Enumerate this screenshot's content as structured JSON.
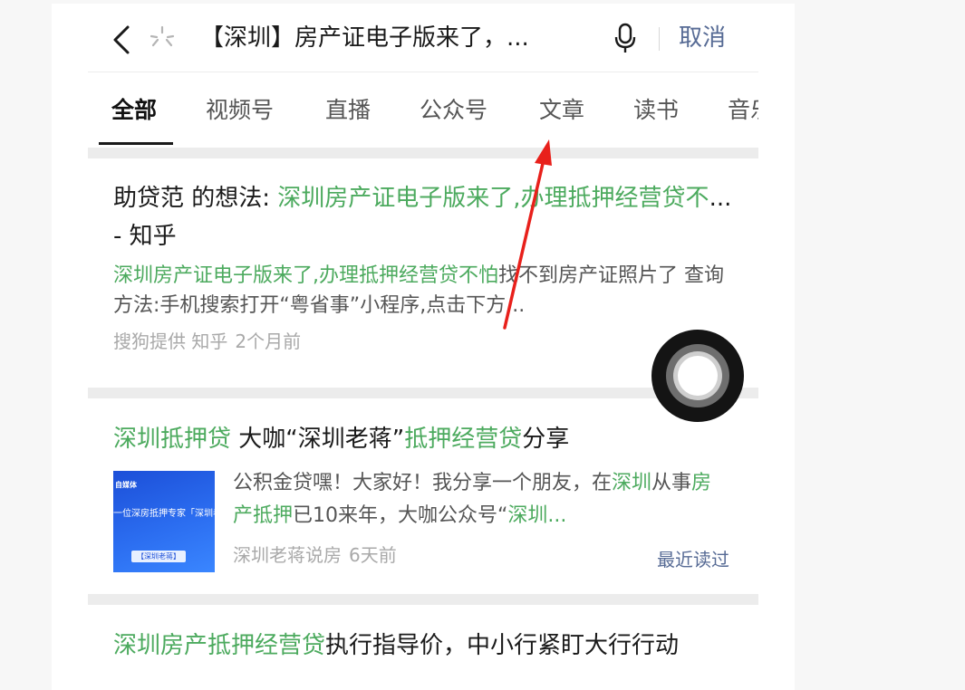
{
  "search": {
    "query": "【深圳】房产证电子版来了，...",
    "cancel_label": "取消"
  },
  "tabs": [
    {
      "label": "全部",
      "active": true
    },
    {
      "label": "视频号"
    },
    {
      "label": "直播"
    },
    {
      "label": "公众号"
    },
    {
      "label": "文章"
    },
    {
      "label": "读书"
    },
    {
      "label": "音乐"
    }
  ],
  "results": [
    {
      "title_plain": "助贷范 的想法: ",
      "title_hl": "深圳房产证电子版来了,办理抵押经营贷不",
      "title_tail": "... - 知乎",
      "desc_hl": "深圳房产证电子版来了,办理抵押经营贷不怕",
      "desc_plain": "找不到房产证照片了 查询方法:手机搜索打开“粤省事”小程序,点击下方...",
      "source": "搜狗提供 知乎",
      "time": "2个月前"
    },
    {
      "title_hl1": "深圳抵押贷",
      "title_plain1": " 大咖“深圳老蒋”",
      "title_hl2": "抵押经营贷",
      "title_plain2": "分享",
      "desc_p1": "公积金贷嘿！大家好！我分享一个朋友，在",
      "desc_h1": "深圳",
      "desc_p2": "从事",
      "desc_h2": "房产抵押",
      "desc_p3": "已10来年，大咖公众号“",
      "desc_h3": "深圳...",
      "source": "深圳老蒋说房",
      "time": "6天前",
      "badge": "最近读过",
      "thumb_line1": "自媒体",
      "thumb_line2": "一位深房抵押专家「深圳老",
      "thumb_line3": "【深圳老蒋】"
    },
    {
      "title_hl": "深圳房产抵押经营贷",
      "title_plain": "执行指导价，中小行紧盯大行行动"
    }
  ],
  "icons": {
    "back": "chevron-left-icon",
    "loading": "loading-spinner-icon",
    "mic": "microphone-icon",
    "assistive": "assistive-touch-icon",
    "annotation": "red-arrow-annotation"
  },
  "colors": {
    "highlight": "#4caa5e",
    "link": "#576b95",
    "arrow": "#e8201b"
  }
}
